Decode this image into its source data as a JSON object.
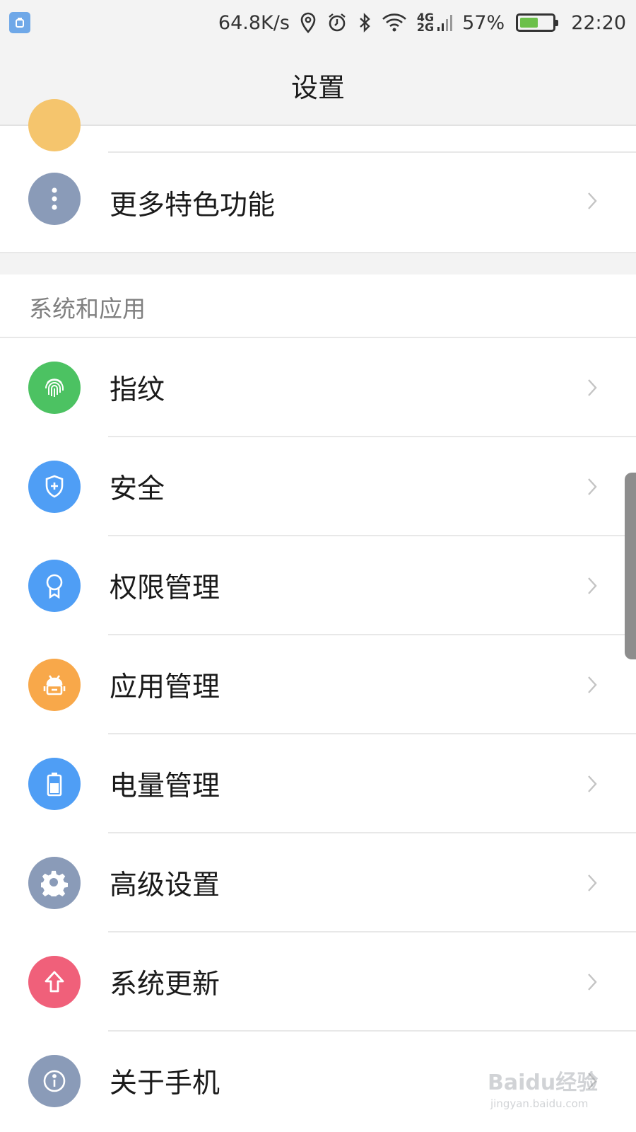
{
  "status_bar": {
    "speed": "64.8K/s",
    "net_top": "4G",
    "net_bottom": "2G",
    "battery_percent": "57%",
    "battery_level": 0.57,
    "time": "22:20",
    "icons": [
      "location-icon",
      "alarm-icon",
      "bluetooth-icon",
      "wifi-icon",
      "signal-icon",
      "battery-icon"
    ]
  },
  "header": {
    "title": "设置"
  },
  "group_top": {
    "items": [
      {
        "label": "更多特色功能",
        "icon": "more-dots-icon",
        "color": "#8a9bb8"
      }
    ]
  },
  "section_system": {
    "title": "系统和应用",
    "items": [
      {
        "label": "指纹",
        "icon": "fingerprint-icon",
        "color": "#4cc262"
      },
      {
        "label": "安全",
        "icon": "shield-icon",
        "color": "#4f9ef5"
      },
      {
        "label": "权限管理",
        "icon": "badge-icon",
        "color": "#4f9ef5"
      },
      {
        "label": "应用管理",
        "icon": "android-icon",
        "color": "#f8a84a"
      },
      {
        "label": "电量管理",
        "icon": "battery-icon",
        "color": "#4f9ef5"
      },
      {
        "label": "高级设置",
        "icon": "gear-icon",
        "color": "#8a9bb8"
      },
      {
        "label": "系统更新",
        "icon": "upload-arrow-icon",
        "color": "#f0607a"
      },
      {
        "label": "关于手机",
        "icon": "info-icon",
        "color": "#8a9bb8"
      }
    ]
  },
  "watermark": {
    "brand": "Baidu经验",
    "url": "jingyan.baidu.com"
  }
}
